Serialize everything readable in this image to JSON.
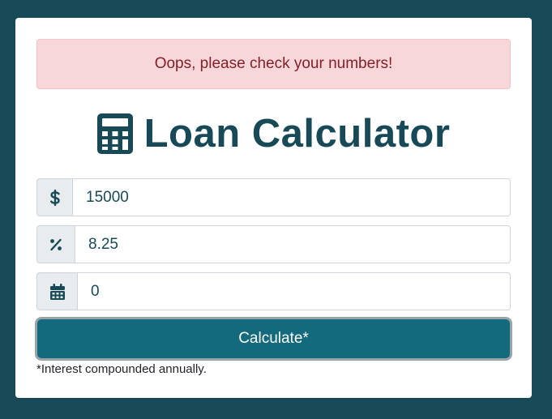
{
  "alert": {
    "message": "Oops, please check your numbers!"
  },
  "header": {
    "icon": "calculator-icon",
    "title": "Loan Calculator"
  },
  "form": {
    "amount": {
      "icon": "dollar-sign-icon",
      "value": "15000"
    },
    "interest": {
      "icon": "percent-icon",
      "value": "8.25"
    },
    "years": {
      "icon": "calendar-icon",
      "value": "0"
    },
    "submit_label": "Calculate*",
    "footnote": "*Interest compounded annually."
  },
  "colors": {
    "page_background": "#174a56",
    "accent": "#136a7c",
    "alert_background": "#f8d7da",
    "alert_text": "#842029"
  }
}
